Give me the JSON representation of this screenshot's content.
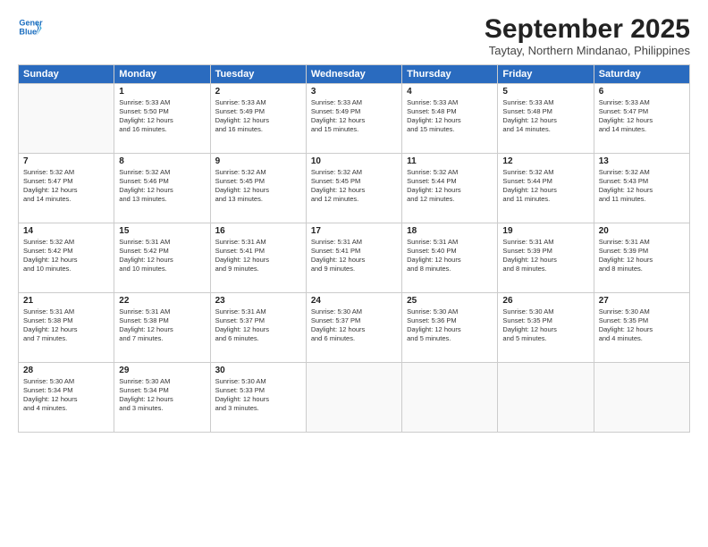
{
  "header": {
    "logo_line1": "General",
    "logo_line2": "Blue",
    "month": "September 2025",
    "location": "Taytay, Northern Mindanao, Philippines"
  },
  "days_of_week": [
    "Sunday",
    "Monday",
    "Tuesday",
    "Wednesday",
    "Thursday",
    "Friday",
    "Saturday"
  ],
  "weeks": [
    [
      {
        "day": "",
        "info": ""
      },
      {
        "day": "1",
        "info": "Sunrise: 5:33 AM\nSunset: 5:50 PM\nDaylight: 12 hours\nand 16 minutes."
      },
      {
        "day": "2",
        "info": "Sunrise: 5:33 AM\nSunset: 5:49 PM\nDaylight: 12 hours\nand 16 minutes."
      },
      {
        "day": "3",
        "info": "Sunrise: 5:33 AM\nSunset: 5:49 PM\nDaylight: 12 hours\nand 15 minutes."
      },
      {
        "day": "4",
        "info": "Sunrise: 5:33 AM\nSunset: 5:48 PM\nDaylight: 12 hours\nand 15 minutes."
      },
      {
        "day": "5",
        "info": "Sunrise: 5:33 AM\nSunset: 5:48 PM\nDaylight: 12 hours\nand 14 minutes."
      },
      {
        "day": "6",
        "info": "Sunrise: 5:33 AM\nSunset: 5:47 PM\nDaylight: 12 hours\nand 14 minutes."
      }
    ],
    [
      {
        "day": "7",
        "info": "Sunrise: 5:32 AM\nSunset: 5:47 PM\nDaylight: 12 hours\nand 14 minutes."
      },
      {
        "day": "8",
        "info": "Sunrise: 5:32 AM\nSunset: 5:46 PM\nDaylight: 12 hours\nand 13 minutes."
      },
      {
        "day": "9",
        "info": "Sunrise: 5:32 AM\nSunset: 5:45 PM\nDaylight: 12 hours\nand 13 minutes."
      },
      {
        "day": "10",
        "info": "Sunrise: 5:32 AM\nSunset: 5:45 PM\nDaylight: 12 hours\nand 12 minutes."
      },
      {
        "day": "11",
        "info": "Sunrise: 5:32 AM\nSunset: 5:44 PM\nDaylight: 12 hours\nand 12 minutes."
      },
      {
        "day": "12",
        "info": "Sunrise: 5:32 AM\nSunset: 5:44 PM\nDaylight: 12 hours\nand 11 minutes."
      },
      {
        "day": "13",
        "info": "Sunrise: 5:32 AM\nSunset: 5:43 PM\nDaylight: 12 hours\nand 11 minutes."
      }
    ],
    [
      {
        "day": "14",
        "info": "Sunrise: 5:32 AM\nSunset: 5:42 PM\nDaylight: 12 hours\nand 10 minutes."
      },
      {
        "day": "15",
        "info": "Sunrise: 5:31 AM\nSunset: 5:42 PM\nDaylight: 12 hours\nand 10 minutes."
      },
      {
        "day": "16",
        "info": "Sunrise: 5:31 AM\nSunset: 5:41 PM\nDaylight: 12 hours\nand 9 minutes."
      },
      {
        "day": "17",
        "info": "Sunrise: 5:31 AM\nSunset: 5:41 PM\nDaylight: 12 hours\nand 9 minutes."
      },
      {
        "day": "18",
        "info": "Sunrise: 5:31 AM\nSunset: 5:40 PM\nDaylight: 12 hours\nand 8 minutes."
      },
      {
        "day": "19",
        "info": "Sunrise: 5:31 AM\nSunset: 5:39 PM\nDaylight: 12 hours\nand 8 minutes."
      },
      {
        "day": "20",
        "info": "Sunrise: 5:31 AM\nSunset: 5:39 PM\nDaylight: 12 hours\nand 8 minutes."
      }
    ],
    [
      {
        "day": "21",
        "info": "Sunrise: 5:31 AM\nSunset: 5:38 PM\nDaylight: 12 hours\nand 7 minutes."
      },
      {
        "day": "22",
        "info": "Sunrise: 5:31 AM\nSunset: 5:38 PM\nDaylight: 12 hours\nand 7 minutes."
      },
      {
        "day": "23",
        "info": "Sunrise: 5:31 AM\nSunset: 5:37 PM\nDaylight: 12 hours\nand 6 minutes."
      },
      {
        "day": "24",
        "info": "Sunrise: 5:30 AM\nSunset: 5:37 PM\nDaylight: 12 hours\nand 6 minutes."
      },
      {
        "day": "25",
        "info": "Sunrise: 5:30 AM\nSunset: 5:36 PM\nDaylight: 12 hours\nand 5 minutes."
      },
      {
        "day": "26",
        "info": "Sunrise: 5:30 AM\nSunset: 5:35 PM\nDaylight: 12 hours\nand 5 minutes."
      },
      {
        "day": "27",
        "info": "Sunrise: 5:30 AM\nSunset: 5:35 PM\nDaylight: 12 hours\nand 4 minutes."
      }
    ],
    [
      {
        "day": "28",
        "info": "Sunrise: 5:30 AM\nSunset: 5:34 PM\nDaylight: 12 hours\nand 4 minutes."
      },
      {
        "day": "29",
        "info": "Sunrise: 5:30 AM\nSunset: 5:34 PM\nDaylight: 12 hours\nand 3 minutes."
      },
      {
        "day": "30",
        "info": "Sunrise: 5:30 AM\nSunset: 5:33 PM\nDaylight: 12 hours\nand 3 minutes."
      },
      {
        "day": "",
        "info": ""
      },
      {
        "day": "",
        "info": ""
      },
      {
        "day": "",
        "info": ""
      },
      {
        "day": "",
        "info": ""
      }
    ]
  ]
}
